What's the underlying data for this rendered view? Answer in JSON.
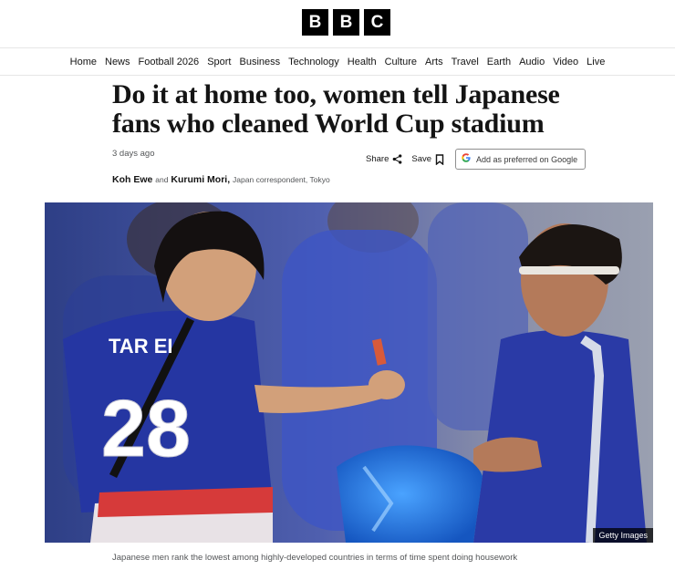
{
  "brand": {
    "letters": [
      "B",
      "B",
      "C"
    ]
  },
  "nav": {
    "items": [
      "Home",
      "News",
      "Football 2026",
      "Sport",
      "Business",
      "Technology",
      "Health",
      "Culture",
      "Arts",
      "Travel",
      "Earth",
      "Audio",
      "Video",
      "Live"
    ]
  },
  "article": {
    "headline": "Do it at home too, women tell Japanese fans who cleaned World Cup stadium",
    "timestamp": "3 days ago",
    "share_label": "Share",
    "save_label": "Save",
    "google_label": "Add as preferred on Google",
    "byline": {
      "author1": "Koh Ewe",
      "and": "and",
      "author2": "Kurumi Mori,",
      "role": "Japan correspondent, Tokyo"
    },
    "image": {
      "credit": "Getty Images",
      "jersey_name": "TAR EI",
      "jersey_number": "28"
    },
    "caption": "Japanese men rank the lowest among highly-developed countries in terms of time spent doing housework"
  },
  "colors": {
    "accent": "#000000",
    "jersey": "#2b3a9c",
    "bag": "#1f6fd6"
  }
}
